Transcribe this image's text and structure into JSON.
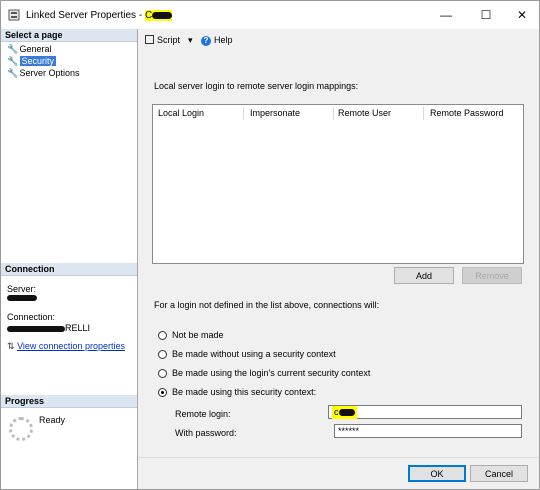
{
  "window": {
    "title_prefix": "Linked Server Properties - ",
    "title_server": "C",
    "controls": {
      "minimize": "—",
      "maximize": "☐",
      "close": "✕"
    }
  },
  "left": {
    "select_page_header": "Select a page",
    "pages": [
      {
        "label": "General",
        "selected": false
      },
      {
        "label": "Security",
        "selected": true
      },
      {
        "label": "Server Options",
        "selected": false
      }
    ],
    "connection_header": "Connection",
    "server_label": "Server:",
    "connection_label": "Connection:",
    "connection_value_tail": "RELLI",
    "view_connection_link": "View connection properties",
    "progress_header": "Progress",
    "progress_status": "Ready"
  },
  "toolbar": {
    "script_label": "Script",
    "help_label": "Help"
  },
  "main": {
    "mappings_label": "Local server login to remote server login mappings:",
    "columns": [
      "Local Login",
      "Impersonate",
      "Remote User",
      "Remote Password"
    ],
    "add_label": "Add",
    "remove_label": "Remove",
    "fallback_label": "For a login not defined in the list above, connections will:",
    "options": [
      {
        "label": "Not be made",
        "checked": false
      },
      {
        "label": "Be made without using a security context",
        "checked": false
      },
      {
        "label": "Be made using the login's current security context",
        "checked": false
      },
      {
        "label": "Be made using this security context:",
        "checked": true
      }
    ],
    "remote_login_label": "Remote login:",
    "remote_login_value": "c",
    "password_label": "With password:",
    "password_value": "******"
  },
  "footer": {
    "ok_label": "OK",
    "cancel_label": "Cancel"
  },
  "colors": {
    "highlight": "#ffff00",
    "selection": "#3a7bd5",
    "section_header": "#dce6f0",
    "link": "#0033cc"
  }
}
